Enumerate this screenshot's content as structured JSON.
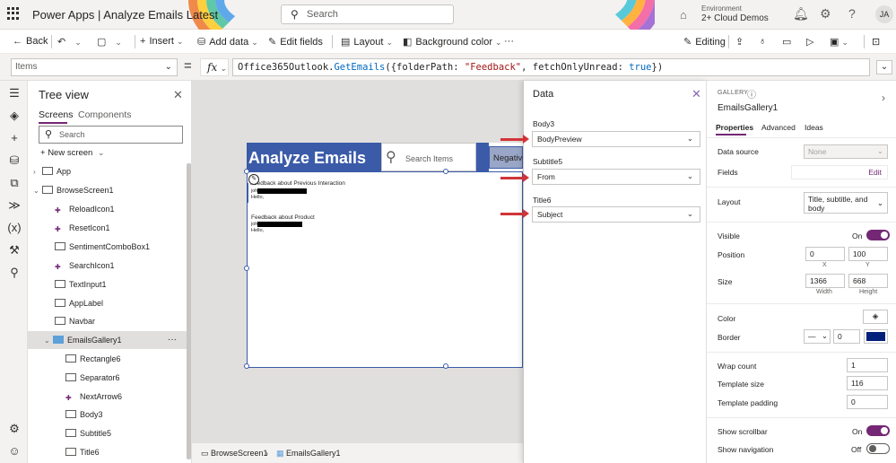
{
  "header": {
    "app_title": "Power Apps  |  Analyze Emails Latest",
    "search_placeholder": "Search",
    "environment_label": "Environment",
    "environment_name": "2+ Cloud Demos",
    "user_initials": "JA"
  },
  "commandbar": {
    "back": "Back",
    "insert": "Insert",
    "add_data": "Add data",
    "edit_fields": "Edit fields",
    "layout": "Layout",
    "background_color": "Background color",
    "more": "···",
    "editing": "Editing"
  },
  "formulabar": {
    "property": "Items",
    "equals": "=",
    "fx": "fx",
    "formula_prefix": "Office365Outlook.",
    "formula_fn": "GetEmails",
    "formula_args1": "({folderPath: ",
    "formula_str": "\"Feedback\"",
    "formula_args2": ", fetchOnlyUnread: ",
    "formula_bool": "true",
    "formula_end": "})"
  },
  "tree": {
    "title": "Tree view",
    "tab_screens": "Screens",
    "tab_components": "Components",
    "search_placeholder": "Search",
    "new_screen": "New screen",
    "nodes": [
      "App",
      "BrowseScreen1",
      "ReloadIcon1",
      "ResetIcon1",
      "SentimentComboBox1",
      "SearchIcon1",
      "TextInput1",
      "AppLabel",
      "Navbar",
      "EmailsGallery1",
      "Rectangle6",
      "Separator6",
      "NextArrow6",
      "Body3",
      "Subtitle5",
      "Title6"
    ],
    "more": "···"
  },
  "canvas": {
    "app_title": "Analyze Emails",
    "search_placeholder": "Search Items",
    "sentiment_value": "Negative",
    "items": [
      {
        "title": "Feedback about Previous Interaction",
        "from_prefix": "joh",
        "body": "Hello,"
      },
      {
        "title": "Feedback about Product",
        "from_prefix": "joh",
        "body": "Hello,"
      }
    ]
  },
  "statusbar": {
    "screen": "BrowseScreen1",
    "control": "EmailsGallery1"
  },
  "data_panel": {
    "title": "Data",
    "fields": [
      {
        "label": "Body3",
        "value": "BodyPreview"
      },
      {
        "label": "Subtitle5",
        "value": "From"
      },
      {
        "label": "Title6",
        "value": "Subject"
      }
    ]
  },
  "properties": {
    "kind": "GALLERY",
    "name": "EmailsGallery1",
    "tabs": [
      "Properties",
      "Advanced",
      "Ideas"
    ],
    "data_source_label": "Data source",
    "data_source_value": "None",
    "fields_label": "Fields",
    "fields_edit": "Edit",
    "layout_label": "Layout",
    "layout_value": "Title, subtitle, and body",
    "visible_label": "Visible",
    "visible_state": "On",
    "position_label": "Position",
    "position_x": "0",
    "position_y": "100",
    "x_label": "X",
    "y_label": "Y",
    "size_label": "Size",
    "width_value": "1366",
    "height_value": "668",
    "width_label": "Width",
    "height_label": "Height",
    "color_label": "Color",
    "border_label": "Border",
    "border_width": "0",
    "border_color": "#001f7a",
    "wrap_label": "Wrap count",
    "wrap_value": "1",
    "template_size_label": "Template size",
    "template_size_value": "116",
    "template_padding_label": "Template padding",
    "template_padding_value": "0",
    "show_scrollbar_label": "Show scrollbar",
    "show_scrollbar_state": "On",
    "show_navigation_label": "Show navigation",
    "show_navigation_state": "Off"
  },
  "colors": {
    "accent": "#742774",
    "app_blue": "#3b5ba9",
    "arrow_red": "#d13438"
  }
}
